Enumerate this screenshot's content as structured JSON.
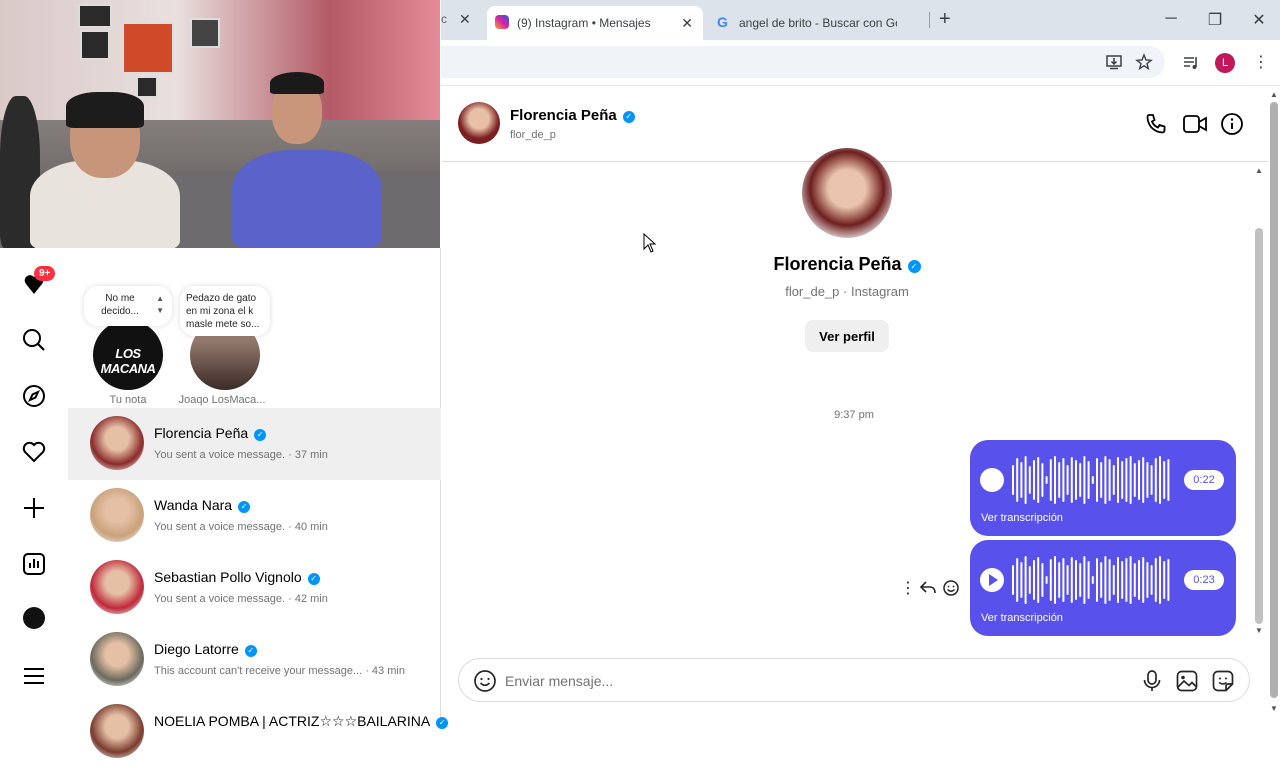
{
  "browser": {
    "tabs": [
      {
        "label": "(9) Instagram • Mensajes",
        "active": true
      },
      {
        "label": "angel de brito - Buscar con Goo",
        "active": false
      }
    ],
    "profile_initial": "L",
    "new_tab": "+",
    "window_controls": {
      "minimize": "─",
      "restore": "❐",
      "close": "✕"
    },
    "tab_close": "✕"
  },
  "sidebar": {
    "notifications_badge": "9+"
  },
  "notes": [
    {
      "text": "No me decido...",
      "label": "Tu nota"
    },
    {
      "text": "Pedazo de gato en mi zona el k masle mete so...",
      "label": "Joaqo LosMaca..."
    }
  ],
  "story_logo_text": "LOS MACANA",
  "conversations": [
    {
      "name": "Florencia Peña",
      "verified": true,
      "sub": "You sent a voice message. · 37 min",
      "selected": true,
      "color": "#8b2a2a"
    },
    {
      "name": "Wanda Nara",
      "verified": true,
      "sub": "You sent a voice message. · 40 min",
      "selected": false,
      "color": "#c9a27a"
    },
    {
      "name": "Sebastian Pollo Vignolo",
      "verified": true,
      "sub": "You sent a voice message. · 42 min",
      "selected": false,
      "color": "#c0283a"
    },
    {
      "name": "Diego Latorre",
      "verified": true,
      "sub": "This account can't receive your message... · 43 min",
      "selected": false,
      "color": "#6b6a5e"
    },
    {
      "name": "NOELIA POMBA | ACTRIZ☆☆☆BAILARINA",
      "verified": true,
      "sub": "",
      "selected": false,
      "color": "#7a3b2e"
    }
  ],
  "chat": {
    "header_name": "Florencia Peña",
    "header_username": "flor_de_p",
    "profile_name": "Florencia Peña",
    "profile_sub": "flor_de_p · Instagram",
    "view_profile": "Ver perfil",
    "timestamp": "9:37 pm",
    "messages": [
      {
        "type": "voice",
        "duration": "0:22",
        "transcript_link": "Ver transcripción"
      },
      {
        "type": "voice",
        "duration": "0:23",
        "transcript_link": "Ver transcripción"
      }
    ],
    "composer_placeholder": "Enviar mensaje..."
  },
  "colors": {
    "accent": "#5851ec",
    "verified": "#0095f6",
    "badge": "#ff3040"
  }
}
